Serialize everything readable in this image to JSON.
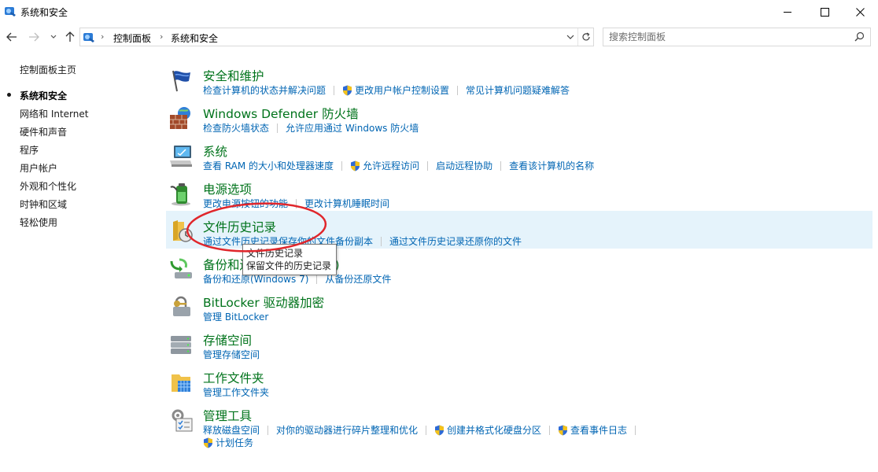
{
  "window": {
    "title": "系统和安全",
    "minimize_label": "minimize-icon",
    "maximize_label": "maximize-icon",
    "close_label": "close-icon"
  },
  "nav": {
    "back": "back-arrow-icon",
    "forward": "forward-arrow-icon",
    "recent": "chevron-down-icon",
    "up": "up-arrow-icon"
  },
  "address": {
    "crumbs": [
      "控制面板",
      "系统和安全"
    ]
  },
  "search": {
    "placeholder": "搜索控制面板"
  },
  "sidebar": {
    "home": "控制面板主页",
    "items": [
      {
        "label": "系统和安全",
        "current": true
      },
      {
        "label": "网络和 Internet"
      },
      {
        "label": "硬件和声音"
      },
      {
        "label": "程序"
      },
      {
        "label": "用户帐户"
      },
      {
        "label": "外观和个性化"
      },
      {
        "label": "时钟和区域"
      },
      {
        "label": "轻松使用"
      }
    ]
  },
  "categories": [
    {
      "title": "安全和维护",
      "links": [
        "检查计算机的状态并解决问题",
        "更改用户帐户控制设置",
        "常见计算机问题疑难解答"
      ]
    },
    {
      "title": "Windows Defender 防火墙",
      "links": [
        "检查防火墙状态",
        "允许应用通过 Windows 防火墙"
      ]
    },
    {
      "title": "系统",
      "links": [
        "查看 RAM 的大小和处理器速度",
        "允许远程访问",
        "启动远程协助",
        "查看该计算机的名称"
      ]
    },
    {
      "title": "电源选项",
      "links": [
        "更改电源按钮的功能",
        "更改计算机睡眠时间"
      ]
    },
    {
      "title": "文件历史记录",
      "links": [
        "通过文件历史记录保存你的文件备份副本",
        "通过文件历史记录还原你的文件"
      ]
    },
    {
      "title": "备份和还原(Windows 7)",
      "links": [
        "备份和还原(Windows 7)",
        "从备份还原文件"
      ]
    },
    {
      "title": "BitLocker 驱动器加密",
      "links": [
        "管理 BitLocker"
      ]
    },
    {
      "title": "存储空间",
      "links": [
        "管理存储空间"
      ]
    },
    {
      "title": "工作文件夹",
      "links": [
        "管理工作文件夹"
      ]
    },
    {
      "title": "管理工具",
      "links": [
        "释放磁盘空间",
        "对你的驱动器进行碎片整理和优化",
        "创建并格式化硬盘分区",
        "查看事件日志",
        "计划任务"
      ]
    }
  ],
  "tooltip": {
    "title": "文件历史记录",
    "desc": "保留文件的历史记录"
  },
  "colors": {
    "category_title": "#00731b",
    "link": "#0065b3",
    "hover_bg": "#e5f3fb",
    "annotation_circle": "#e0262b"
  }
}
